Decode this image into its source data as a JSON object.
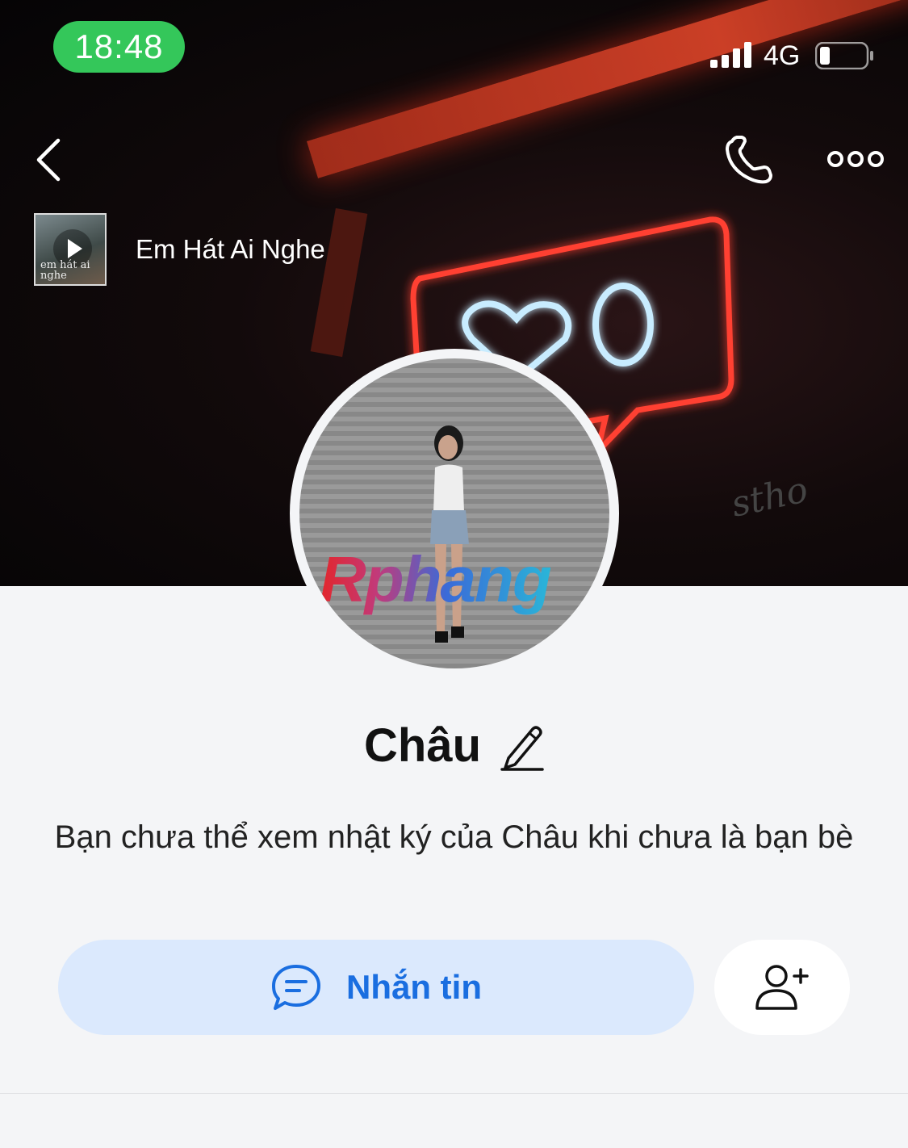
{
  "status_bar": {
    "time": "18:48",
    "network": "4G"
  },
  "nav": {
    "back_icon": "back-chevron-icon",
    "call_icon": "phone-icon",
    "more_icon": "more-dots-icon"
  },
  "music": {
    "title": "Em Hát Ai Nghe",
    "thumb_caption": "em hát ai nghe"
  },
  "profile": {
    "avatar_watermark": "Rphang",
    "name": "Châu",
    "description": "Bạn chưa thể xem nhật ký của Châu khi chưa là bạn bè"
  },
  "actions": {
    "message_label": "Nhắn tin",
    "message_icon": "chat-bubble-icon",
    "add_friend_icon": "add-friend-icon"
  },
  "colors": {
    "accent": "#1a6ee0",
    "button_bg": "#dbe9fd",
    "time_pill": "#34c75a",
    "neon_red": "#ff3b30",
    "neon_blue": "#bfe8ff"
  }
}
